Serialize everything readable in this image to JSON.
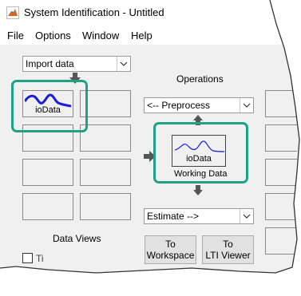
{
  "window": {
    "title": "System Identification - Untitled",
    "app_icon": "matlab-icon"
  },
  "menu": {
    "items": [
      "File",
      "Options",
      "Window",
      "Help"
    ]
  },
  "import": {
    "value": "Import data"
  },
  "data_views": {
    "label": "Data Views",
    "checkbox_partial": "Ti"
  },
  "slots": {
    "first_label": "ioData"
  },
  "operations": {
    "heading": "Operations",
    "preprocess": "<-- Preprocess",
    "estimate": "Estimate -->"
  },
  "working_data": {
    "name": "ioData",
    "caption": "Working Data"
  },
  "buttons": {
    "to_workspace": [
      "To",
      "Workspace"
    ],
    "to_lti": [
      "To",
      "LTI Viewer"
    ]
  },
  "colors": {
    "highlight": "#21a088",
    "signal": "#1b1bdc"
  }
}
